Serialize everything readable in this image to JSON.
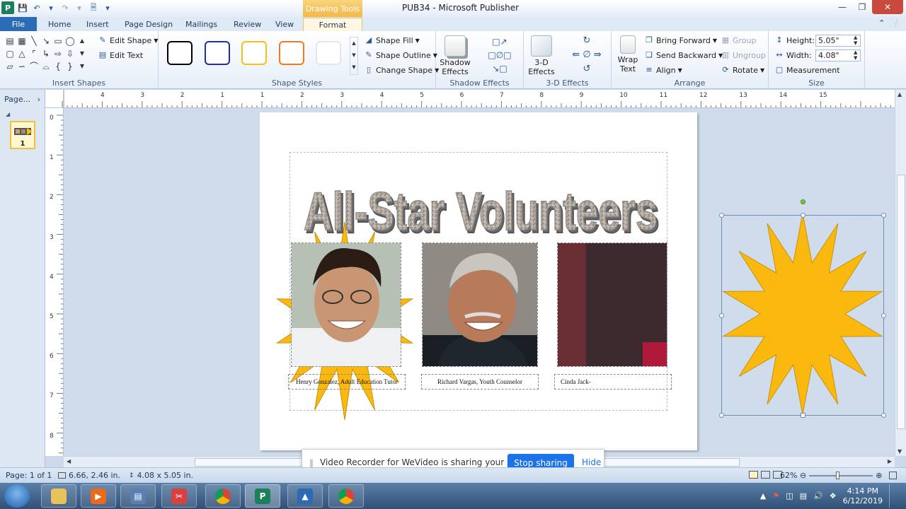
{
  "titlebar": {
    "context_tab": "Drawing Tools",
    "document": "PUB34",
    "separator": " - ",
    "app": "Microsoft Publisher"
  },
  "tabs": [
    "File",
    "Home",
    "Insert",
    "Page Design",
    "Mailings",
    "Review",
    "View",
    "Format"
  ],
  "ribbon": {
    "insert_shapes": {
      "edit_shape": "Edit Shape",
      "edit_text": "Edit Text",
      "label": "Insert Shapes"
    },
    "shape_styles": {
      "swatch_colors": [
        "#000000",
        "#1f2fa8",
        "#f2c11a",
        "#f07b1e",
        "#e6e6e6"
      ],
      "shape_fill": "Shape Fill",
      "shape_outline": "Shape Outline",
      "change_shape": "Change Shape",
      "label": "Shape Styles"
    },
    "shadow": {
      "button": "Shadow Effects",
      "label": "Shadow Effects"
    },
    "three_d": {
      "button": "3-D Effects",
      "label": "3-D Effects"
    },
    "arrange": {
      "wrap_text": "Wrap Text",
      "bring_forward": "Bring Forward",
      "send_backward": "Send Backward",
      "align": "Align",
      "group": "Group",
      "ungroup": "Ungroup",
      "rotate": "Rotate",
      "label": "Arrange"
    },
    "size": {
      "height_label": "Height:",
      "height_value": "5.05\"",
      "width_label": "Width:",
      "width_value": "4.08\"",
      "measurement": "Measurement",
      "label": "Size"
    }
  },
  "pagenav": {
    "title": "Page...",
    "page_number": "1"
  },
  "ruler": {
    "h_labels": [
      "4",
      "3",
      "2",
      "1",
      "1",
      "2",
      "3",
      "4",
      "5",
      "6",
      "7",
      "8",
      "9",
      "10",
      "11",
      "12",
      "13",
      "14",
      "15"
    ],
    "v_labels": [
      "0",
      "1",
      "2",
      "3",
      "4",
      "5",
      "6",
      "7",
      "8"
    ]
  },
  "document": {
    "wordart": "All-Star Volunteers",
    "captions": [
      "Henry Gonzalez, Adult Education Tutor",
      "Richard Vargas, Youth Counselor",
      "Cinda Jack-"
    ],
    "starburst_color": "#fbb90f"
  },
  "share_banner": {
    "text": "Video Recorder for WeVideo is sharing your screen.",
    "stop": "Stop sharing",
    "hide": "Hide"
  },
  "statusbar": {
    "page": "Page: 1 of 1",
    "position": "6.66, 2.46 in.",
    "size": "4.08 x 5.05 in.",
    "zoom": "62%"
  },
  "taskbar": {
    "time": "4:14 PM",
    "date": "6/12/2019"
  }
}
